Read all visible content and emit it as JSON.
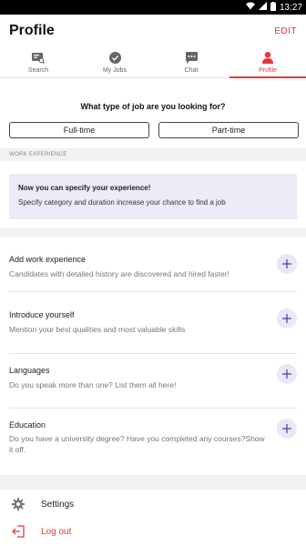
{
  "status_bar": {
    "time": "13:27"
  },
  "header": {
    "title": "Profile",
    "edit_label": "EDIT"
  },
  "tabs": [
    {
      "label": "Search",
      "icon": "search-card-icon"
    },
    {
      "label": "My Jobs",
      "icon": "check-circle-icon"
    },
    {
      "label": "Chat",
      "icon": "chat-icon"
    },
    {
      "label": "Profile",
      "icon": "person-icon",
      "active": true
    }
  ],
  "job_type": {
    "question": "What type of job are you looking for?",
    "options": [
      "Full-time",
      "Part-time"
    ]
  },
  "work_experience": {
    "section_label": "WORK EXPERIENCE",
    "card_title": "Now you can specify your experience!",
    "card_text": "Specify category and duration increase your chance to find a job"
  },
  "profile_items": [
    {
      "title": "Add work experience",
      "description": "Candidates with detailed history are discovered and hired faster!"
    },
    {
      "title": "Introduce yourself",
      "description": "Mention your best qualities and most valuable skills"
    },
    {
      "title": "Languages",
      "description": "Do you speak more than one? List them all here!"
    },
    {
      "title": "Education",
      "description": "Do you have a university degree? Have you completed any courses?Show it off."
    }
  ],
  "menu": {
    "settings_label": "Settings",
    "logout_label": "Log out"
  },
  "colors": {
    "accent": "#e53935",
    "card_bg": "#ececf8",
    "plus_bg": "#e8e8f6",
    "plus_icon": "#3f3fa8"
  }
}
